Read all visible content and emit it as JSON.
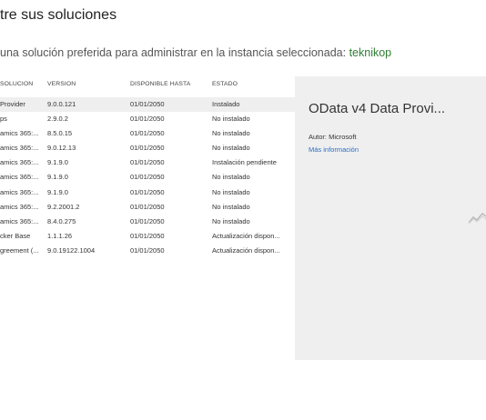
{
  "header": {
    "title": "tre sus soluciones",
    "subtitle": "una solución preferida para administrar en la instancia seleccionada: ",
    "instance": "teknikop"
  },
  "table": {
    "columns": [
      "SOLUCIÓN",
      "VERSIÓN",
      "DISPONIBLE HASTA",
      "ESTADO"
    ],
    "rows": [
      {
        "name": "Provider",
        "version": "9.0.0.121",
        "available": "01/01/2050",
        "status": "Instalado",
        "selected": true
      },
      {
        "name": "ps",
        "version": "2.9.0.2",
        "available": "01/01/2050",
        "status": "No instalado"
      },
      {
        "name": "amics 365:...",
        "version": "8.5.0.15",
        "available": "01/01/2050",
        "status": "No instalado"
      },
      {
        "name": "amics 365:...",
        "version": "9.0.12.13",
        "available": "01/01/2050",
        "status": "No instalado"
      },
      {
        "name": "amics 365:...",
        "version": "9.1.9.0",
        "available": "01/01/2050",
        "status": "Instalación pendiente"
      },
      {
        "name": "amics 365:...",
        "version": "9.1.9.0",
        "available": "01/01/2050",
        "status": "No instalado"
      },
      {
        "name": "amics 365:...",
        "version": "9.1.9.0",
        "available": "01/01/2050",
        "status": "No instalado"
      },
      {
        "name": "amics 365:...",
        "version": "9.2.2001.2",
        "available": "01/01/2050",
        "status": "No instalado"
      },
      {
        "name": "amics 365:...",
        "version": "8.4.0.275",
        "available": "01/01/2050",
        "status": "No instalado"
      },
      {
        "name": "cker Base",
        "version": "1.1.1.26",
        "available": "01/01/2050",
        "status": "Actualización dispon..."
      },
      {
        "name": "greement (...",
        "version": "9.0.19122.1004",
        "available": "01/01/2050",
        "status": "Actualización dispon..."
      }
    ]
  },
  "details": {
    "name": "OData v4 Data Provi...",
    "author": "Autor: Microsoft",
    "more_info": "Más información",
    "icon": "chart-icon"
  },
  "colors": {
    "instance": "#2e7d32",
    "link": "#2a6fbf",
    "selected_row": "#efefef",
    "details_panel": "#efefef"
  }
}
